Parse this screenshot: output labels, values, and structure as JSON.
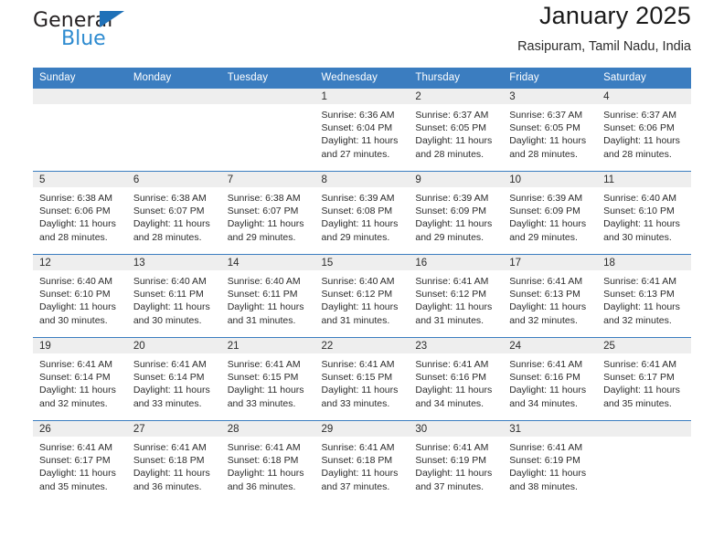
{
  "logo": {
    "general_text": "General",
    "blue_text": "Blue",
    "triangle_color": "#1f71b8",
    "blue_color": "#2e8bd0"
  },
  "header": {
    "title": "January 2025",
    "subtitle": "Rasipuram, Tamil Nadu, India",
    "header_bg": "#3b7dc0",
    "daynum_bg": "#eeeeee"
  },
  "weekdays": [
    "Sunday",
    "Monday",
    "Tuesday",
    "Wednesday",
    "Thursday",
    "Friday",
    "Saturday"
  ],
  "labels": {
    "sunrise_prefix": "Sunrise: ",
    "sunset_prefix": "Sunset: ",
    "daylight_prefix": "Daylight: "
  },
  "weeks": [
    [
      {
        "day": "",
        "sunrise": "",
        "sunset": "",
        "daylight_line1": "",
        "daylight_line2": ""
      },
      {
        "day": "",
        "sunrise": "",
        "sunset": "",
        "daylight_line1": "",
        "daylight_line2": ""
      },
      {
        "day": "",
        "sunrise": "",
        "sunset": "",
        "daylight_line1": "",
        "daylight_line2": ""
      },
      {
        "day": "1",
        "sunrise": "Sunrise: 6:36 AM",
        "sunset": "Sunset: 6:04 PM",
        "daylight_line1": "Daylight: 11 hours",
        "daylight_line2": "and 27 minutes."
      },
      {
        "day": "2",
        "sunrise": "Sunrise: 6:37 AM",
        "sunset": "Sunset: 6:05 PM",
        "daylight_line1": "Daylight: 11 hours",
        "daylight_line2": "and 28 minutes."
      },
      {
        "day": "3",
        "sunrise": "Sunrise: 6:37 AM",
        "sunset": "Sunset: 6:05 PM",
        "daylight_line1": "Daylight: 11 hours",
        "daylight_line2": "and 28 minutes."
      },
      {
        "day": "4",
        "sunrise": "Sunrise: 6:37 AM",
        "sunset": "Sunset: 6:06 PM",
        "daylight_line1": "Daylight: 11 hours",
        "daylight_line2": "and 28 minutes."
      }
    ],
    [
      {
        "day": "5",
        "sunrise": "Sunrise: 6:38 AM",
        "sunset": "Sunset: 6:06 PM",
        "daylight_line1": "Daylight: 11 hours",
        "daylight_line2": "and 28 minutes."
      },
      {
        "day": "6",
        "sunrise": "Sunrise: 6:38 AM",
        "sunset": "Sunset: 6:07 PM",
        "daylight_line1": "Daylight: 11 hours",
        "daylight_line2": "and 28 minutes."
      },
      {
        "day": "7",
        "sunrise": "Sunrise: 6:38 AM",
        "sunset": "Sunset: 6:07 PM",
        "daylight_line1": "Daylight: 11 hours",
        "daylight_line2": "and 29 minutes."
      },
      {
        "day": "8",
        "sunrise": "Sunrise: 6:39 AM",
        "sunset": "Sunset: 6:08 PM",
        "daylight_line1": "Daylight: 11 hours",
        "daylight_line2": "and 29 minutes."
      },
      {
        "day": "9",
        "sunrise": "Sunrise: 6:39 AM",
        "sunset": "Sunset: 6:09 PM",
        "daylight_line1": "Daylight: 11 hours",
        "daylight_line2": "and 29 minutes."
      },
      {
        "day": "10",
        "sunrise": "Sunrise: 6:39 AM",
        "sunset": "Sunset: 6:09 PM",
        "daylight_line1": "Daylight: 11 hours",
        "daylight_line2": "and 29 minutes."
      },
      {
        "day": "11",
        "sunrise": "Sunrise: 6:40 AM",
        "sunset": "Sunset: 6:10 PM",
        "daylight_line1": "Daylight: 11 hours",
        "daylight_line2": "and 30 minutes."
      }
    ],
    [
      {
        "day": "12",
        "sunrise": "Sunrise: 6:40 AM",
        "sunset": "Sunset: 6:10 PM",
        "daylight_line1": "Daylight: 11 hours",
        "daylight_line2": "and 30 minutes."
      },
      {
        "day": "13",
        "sunrise": "Sunrise: 6:40 AM",
        "sunset": "Sunset: 6:11 PM",
        "daylight_line1": "Daylight: 11 hours",
        "daylight_line2": "and 30 minutes."
      },
      {
        "day": "14",
        "sunrise": "Sunrise: 6:40 AM",
        "sunset": "Sunset: 6:11 PM",
        "daylight_line1": "Daylight: 11 hours",
        "daylight_line2": "and 31 minutes."
      },
      {
        "day": "15",
        "sunrise": "Sunrise: 6:40 AM",
        "sunset": "Sunset: 6:12 PM",
        "daylight_line1": "Daylight: 11 hours",
        "daylight_line2": "and 31 minutes."
      },
      {
        "day": "16",
        "sunrise": "Sunrise: 6:41 AM",
        "sunset": "Sunset: 6:12 PM",
        "daylight_line1": "Daylight: 11 hours",
        "daylight_line2": "and 31 minutes."
      },
      {
        "day": "17",
        "sunrise": "Sunrise: 6:41 AM",
        "sunset": "Sunset: 6:13 PM",
        "daylight_line1": "Daylight: 11 hours",
        "daylight_line2": "and 32 minutes."
      },
      {
        "day": "18",
        "sunrise": "Sunrise: 6:41 AM",
        "sunset": "Sunset: 6:13 PM",
        "daylight_line1": "Daylight: 11 hours",
        "daylight_line2": "and 32 minutes."
      }
    ],
    [
      {
        "day": "19",
        "sunrise": "Sunrise: 6:41 AM",
        "sunset": "Sunset: 6:14 PM",
        "daylight_line1": "Daylight: 11 hours",
        "daylight_line2": "and 32 minutes."
      },
      {
        "day": "20",
        "sunrise": "Sunrise: 6:41 AM",
        "sunset": "Sunset: 6:14 PM",
        "daylight_line1": "Daylight: 11 hours",
        "daylight_line2": "and 33 minutes."
      },
      {
        "day": "21",
        "sunrise": "Sunrise: 6:41 AM",
        "sunset": "Sunset: 6:15 PM",
        "daylight_line1": "Daylight: 11 hours",
        "daylight_line2": "and 33 minutes."
      },
      {
        "day": "22",
        "sunrise": "Sunrise: 6:41 AM",
        "sunset": "Sunset: 6:15 PM",
        "daylight_line1": "Daylight: 11 hours",
        "daylight_line2": "and 33 minutes."
      },
      {
        "day": "23",
        "sunrise": "Sunrise: 6:41 AM",
        "sunset": "Sunset: 6:16 PM",
        "daylight_line1": "Daylight: 11 hours",
        "daylight_line2": "and 34 minutes."
      },
      {
        "day": "24",
        "sunrise": "Sunrise: 6:41 AM",
        "sunset": "Sunset: 6:16 PM",
        "daylight_line1": "Daylight: 11 hours",
        "daylight_line2": "and 34 minutes."
      },
      {
        "day": "25",
        "sunrise": "Sunrise: 6:41 AM",
        "sunset": "Sunset: 6:17 PM",
        "daylight_line1": "Daylight: 11 hours",
        "daylight_line2": "and 35 minutes."
      }
    ],
    [
      {
        "day": "26",
        "sunrise": "Sunrise: 6:41 AM",
        "sunset": "Sunset: 6:17 PM",
        "daylight_line1": "Daylight: 11 hours",
        "daylight_line2": "and 35 minutes."
      },
      {
        "day": "27",
        "sunrise": "Sunrise: 6:41 AM",
        "sunset": "Sunset: 6:18 PM",
        "daylight_line1": "Daylight: 11 hours",
        "daylight_line2": "and 36 minutes."
      },
      {
        "day": "28",
        "sunrise": "Sunrise: 6:41 AM",
        "sunset": "Sunset: 6:18 PM",
        "daylight_line1": "Daylight: 11 hours",
        "daylight_line2": "and 36 minutes."
      },
      {
        "day": "29",
        "sunrise": "Sunrise: 6:41 AM",
        "sunset": "Sunset: 6:18 PM",
        "daylight_line1": "Daylight: 11 hours",
        "daylight_line2": "and 37 minutes."
      },
      {
        "day": "30",
        "sunrise": "Sunrise: 6:41 AM",
        "sunset": "Sunset: 6:19 PM",
        "daylight_line1": "Daylight: 11 hours",
        "daylight_line2": "and 37 minutes."
      },
      {
        "day": "31",
        "sunrise": "Sunrise: 6:41 AM",
        "sunset": "Sunset: 6:19 PM",
        "daylight_line1": "Daylight: 11 hours",
        "daylight_line2": "and 38 minutes."
      },
      {
        "day": "",
        "sunrise": "",
        "sunset": "",
        "daylight_line1": "",
        "daylight_line2": ""
      }
    ]
  ]
}
